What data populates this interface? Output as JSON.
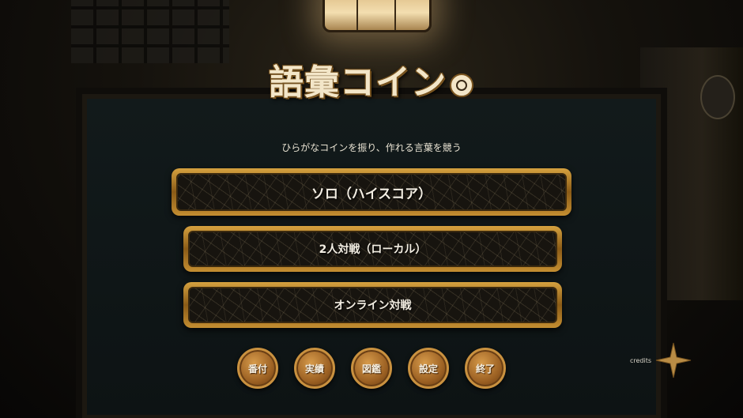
{
  "title": {
    "text": "語彙コイン"
  },
  "subtitle": "ひらがなコインを振り、作れる言葉を競う",
  "menu": [
    {
      "label": "ソロ（ハイスコア）"
    },
    {
      "label": "2人対戦（ローカル）"
    },
    {
      "label": "オンライン対戦"
    }
  ],
  "coins": [
    {
      "label": "番付"
    },
    {
      "label": "実績"
    },
    {
      "label": "図鑑"
    },
    {
      "label": "設定"
    },
    {
      "label": "終了"
    }
  ],
  "credits": {
    "label": "credits",
    "icon": "star-icon"
  },
  "colors": {
    "gold": "#c9913f",
    "panel": "#17140f",
    "text": "#f2ede2"
  }
}
